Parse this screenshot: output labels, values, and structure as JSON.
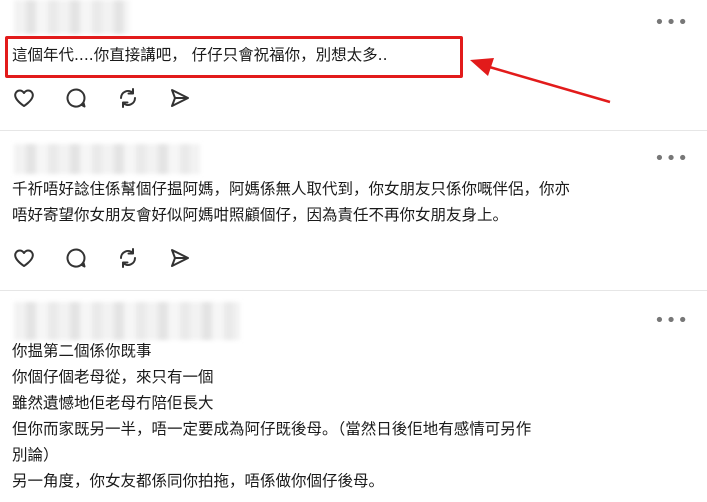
{
  "posts": [
    {
      "text": "這個年代....你直接講吧， 仔仔只會祝福你，別想太多..",
      "highlighted": true
    },
    {
      "text": "千祈唔好諗住係幫個仔揾阿媽，阿媽係無人取代到，你女朋友只係你嘅伴侶，你亦\n唔好寄望你女朋友會好似阿媽咁照顧個仔，因為責任不再你女朋友身上。"
    },
    {
      "text": "你揾第二個係你既事\n你個仔個老母從，來只有一個\n雖然遺憾地佢老母冇陪佢長大\n但你而家既另一半，唔一定要成為阿仔既後母。（當然日後佢地有感情可另作\n別論）\n另一角度，你女友都係同你拍拖，唔係做你個仔後母。"
    }
  ],
  "more_glyph": "•••",
  "icons": [
    "heart-icon",
    "comment-icon",
    "repost-icon",
    "share-icon"
  ],
  "annotation_color": "#e21b1b"
}
